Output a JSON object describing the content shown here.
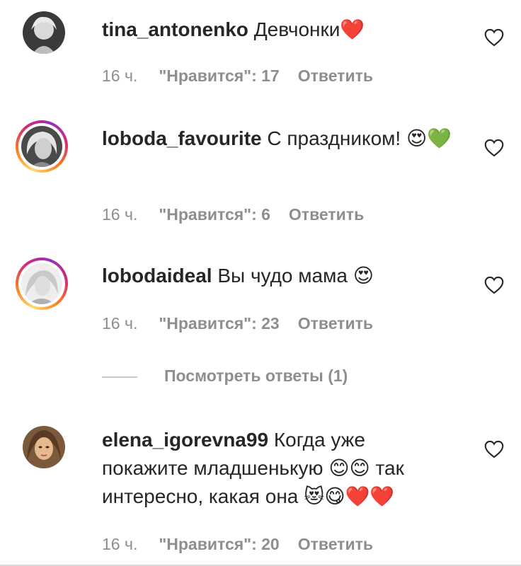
{
  "comments": [
    {
      "username": "tina_antonenko",
      "text": "Девчонки❤️",
      "time": "16 ч.",
      "likes": "\"Нравится\": 17",
      "reply": "Ответить",
      "avatar_ring": false
    },
    {
      "username": "loboda_favourite",
      "text": "С праздником! 😍💚",
      "time": "16 ч.",
      "likes": "\"Нравится\": 6",
      "reply": "Ответить",
      "avatar_ring": true
    },
    {
      "username": "lobodaideal",
      "text": "Вы чудо мама 😍",
      "time": "16 ч.",
      "likes": "\"Нравится\": 23",
      "reply": "Ответить",
      "avatar_ring": true
    },
    {
      "username": "elena_igorevna99",
      "text": "Когда уже покажите младшенькую 😊😊 так интересно, какая она 😻😋❤️❤️",
      "time": "16 ч.",
      "likes": "\"Нравится\": 20",
      "reply": "Ответить",
      "avatar_ring": false
    }
  ],
  "view_replies": "Посмотреть ответы (1)",
  "colors": {
    "text": "#262626",
    "meta": "#8e8e8e",
    "ring_start": "#feda75",
    "ring_mid": "#d62976",
    "ring_end": "#962fbf"
  },
  "icons": {
    "like": "heart-outline-icon"
  }
}
